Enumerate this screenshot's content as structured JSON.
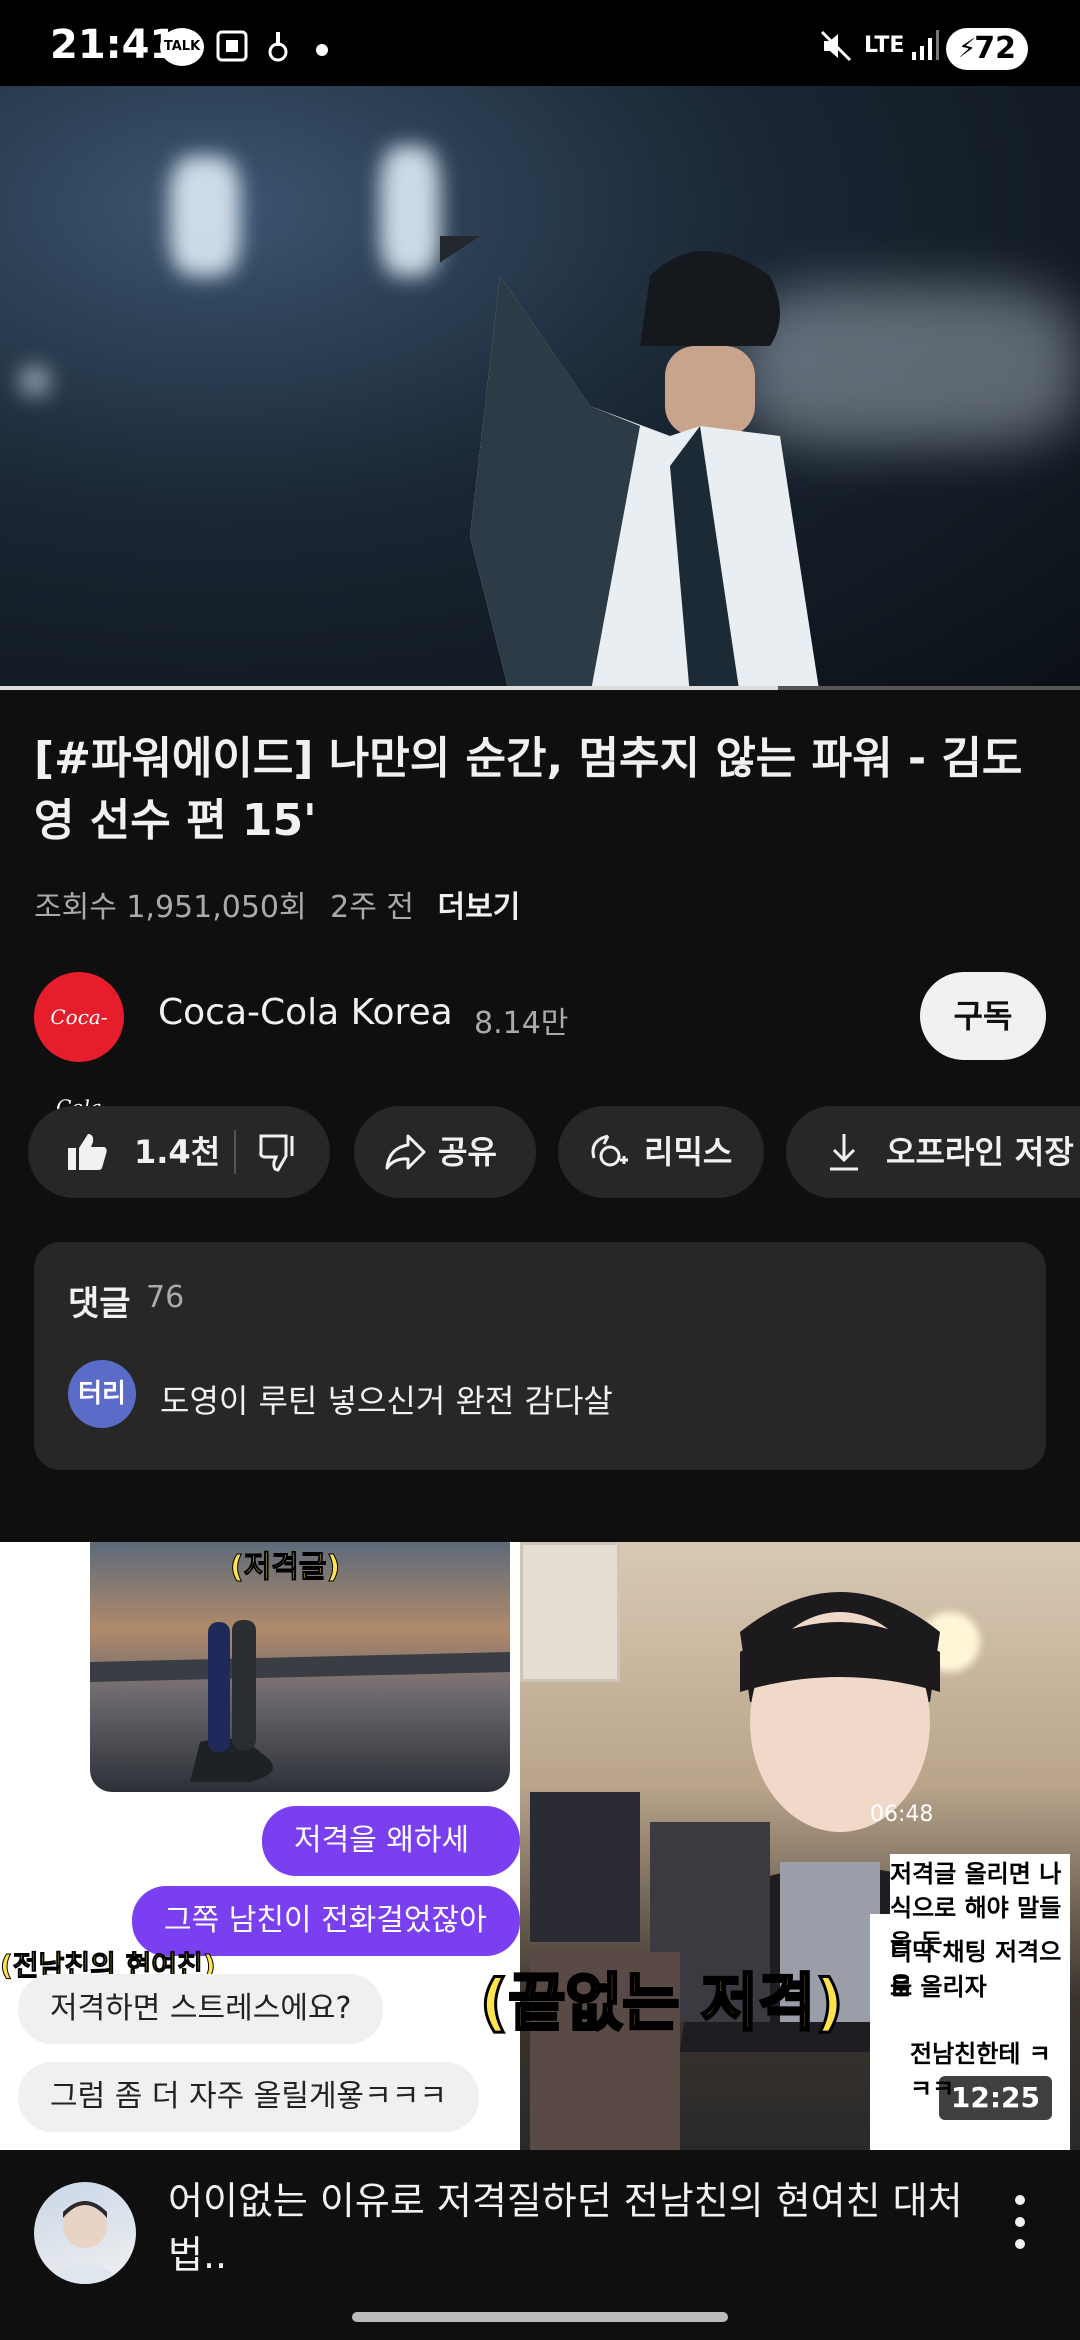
{
  "status_bar": {
    "time": "21:41",
    "talk_badge": "TALK",
    "network": "LTE",
    "battery": "72"
  },
  "video": {
    "progress_fraction": 0.72
  },
  "title": "[#파워에이드] 나만의 순간, 멈추지 않는 파워 - 김도영 선수 편 15'",
  "meta": {
    "views": "조회수 1,951,050회",
    "age": "2주 전",
    "more": "더보기"
  },
  "channel": {
    "logo_text": "Coca-Cola",
    "name": "Coca-Cola Korea",
    "subscribers": "8.14만",
    "subscribe_label": "구독"
  },
  "actions": {
    "like_count": "1.4천",
    "share": "공유",
    "remix": "리믹스",
    "download": "오프라인 저장"
  },
  "comments": {
    "heading": "댓글",
    "count": "76",
    "top_avatar": "터리",
    "top_comment": "도영이 루틴 넣으신거 완전 감다살"
  },
  "next_video": {
    "thumb_labels": {
      "label_top": "(저격글)",
      "label_left": "(전남친의 현여친)",
      "bubble_1": "저격을 왜하세요?",
      "bubble_2": "그쪽 남친이 전화걸었잖아요",
      "bubble_3": "저격하면 스트레스에요?",
      "bubble_4": "그럼 좀 더 자주 올릴게욯ㅋㅋㅋ",
      "big_caption": "(끝없는 저격)",
      "side_1": "저격글 올리면 나도 가면",
      "side_2": "식으로 해야 말들을 듯",
      "side_3": "디막 채팅 저격으로 올리자",
      "side_4": "음",
      "side_5": "전남친한테 ㅋㅋㅋ",
      "timer": "06:48"
    },
    "duration": "12:25",
    "title": "어이없는 이유로 저격질하던 전남친의 현여친 대처법.."
  }
}
